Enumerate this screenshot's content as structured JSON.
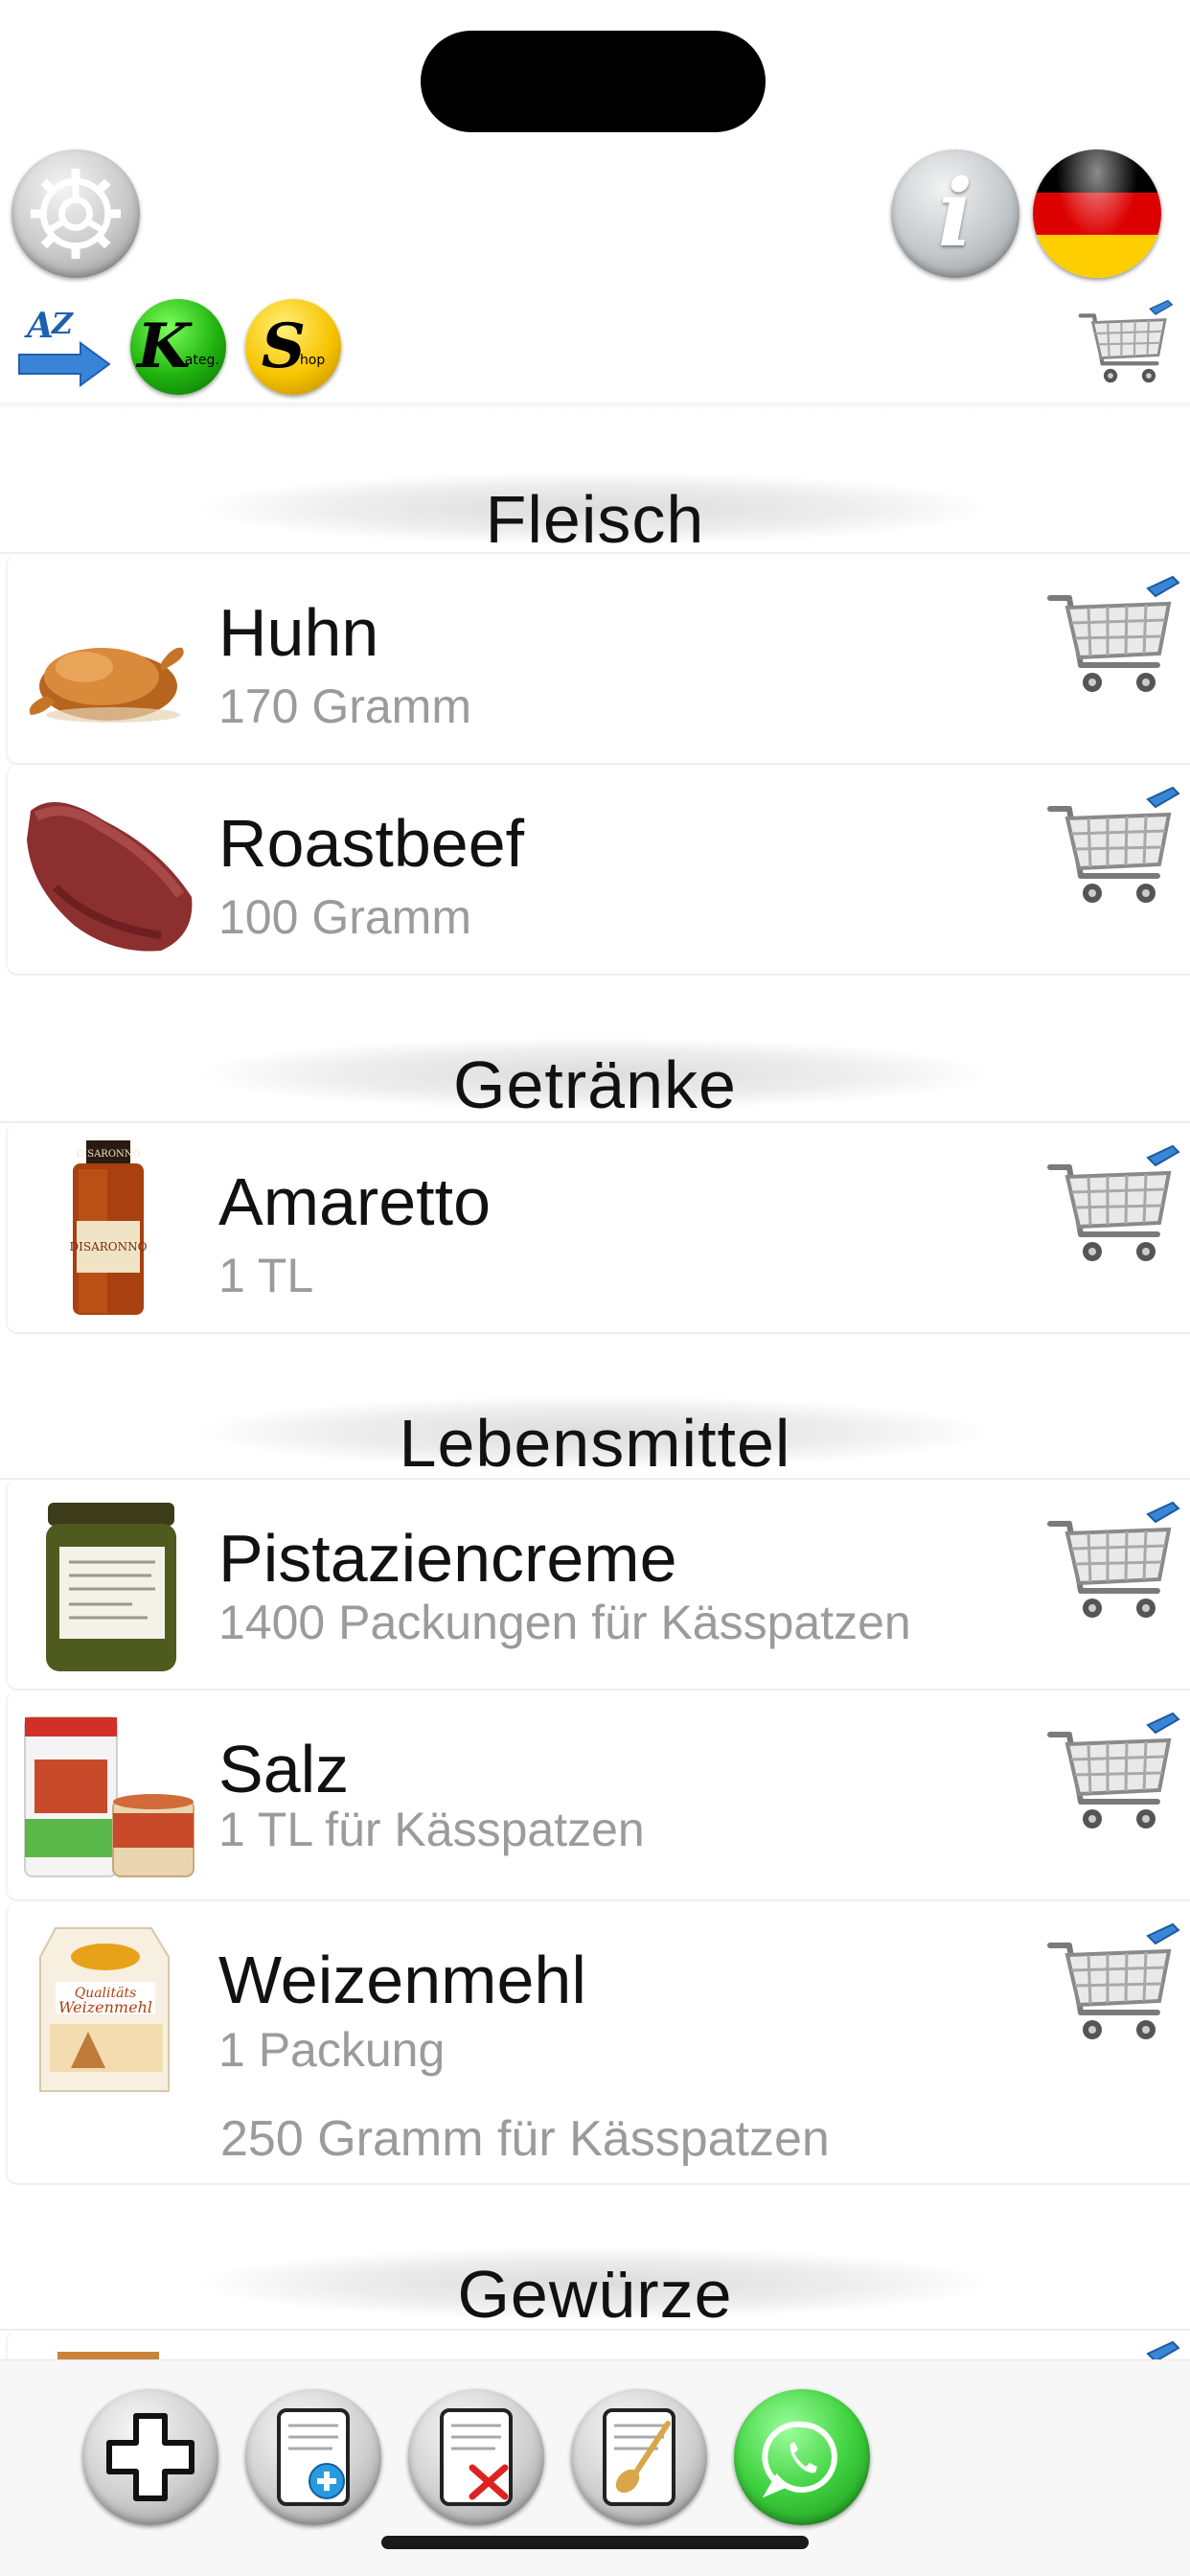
{
  "toolbar": {
    "settings_icon": "gear-icon",
    "info_label": "i",
    "language_flag": "german-flag",
    "sort_icon": "az-sort-icon",
    "category_label": "K",
    "category_sub": "ateg.",
    "shop_label": "S",
    "shop_sub": "hop",
    "cart_icon": "shopping-cart-icon"
  },
  "colors": {
    "flag_black": "#000000",
    "flag_red": "#dd0000",
    "flag_gold": "#ffce00",
    "category_green": "#1fb30e",
    "shop_yellow": "#f7c400",
    "whatsapp_green": "#3fd13f"
  },
  "sections": [
    {
      "title": "Fleisch",
      "items": [
        {
          "name": "Huhn",
          "qty": "170 Gramm",
          "image": "roast-chicken"
        },
        {
          "name": "Roastbeef",
          "qty": "100 Gramm",
          "image": "roastbeef"
        }
      ]
    },
    {
      "title": "Getränke",
      "items": [
        {
          "name": "Amaretto",
          "qty": "1 TL",
          "image": "amaretto-bottle",
          "brand": "DISARONNO"
        }
      ]
    },
    {
      "title": "Lebensmittel",
      "items": [
        {
          "name": "Pistaziencreme",
          "qty": "1400 Packungen für Kässpatzen",
          "image": "pistachio-jar"
        },
        {
          "name": "Salz",
          "qty": "1 TL für Kässpatzen",
          "image": "salt-tins"
        },
        {
          "name": "Weizenmehl",
          "qty": "1 Packung",
          "qty2": "250 Gramm für Kässpatzen",
          "image": "flour-package"
        }
      ]
    },
    {
      "title": "Gewürze",
      "items": []
    }
  ],
  "bottom_bar": {
    "add_icon": "plus-icon",
    "add_recipe_icon": "add-recipe-icon",
    "delete_icon": "delete-recipe-icon",
    "recipe_icon": "recipe-spoon-icon",
    "share_icon": "whatsapp-icon"
  }
}
